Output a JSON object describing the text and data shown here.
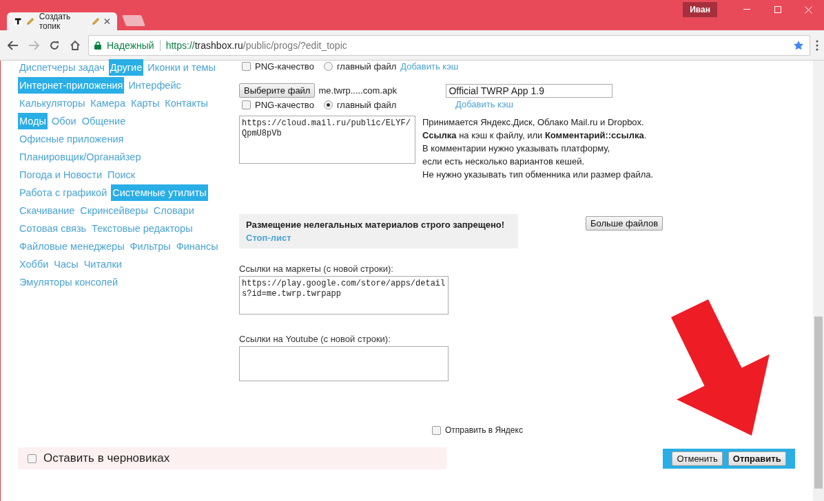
{
  "browser": {
    "tab": {
      "title": "Создать топик",
      "selected": true
    },
    "profile": "Иван",
    "address": {
      "security": "Надежный",
      "scheme": "https://",
      "host": "trashbox.ru",
      "path": "/public/progs/?edit_topic"
    }
  },
  "categories": [
    [
      {
        "label": "Диспетчеры задач",
        "selected": false
      },
      {
        "label": "Другие",
        "selected": true
      },
      {
        "label": "Иконки и темы",
        "selected": false
      }
    ],
    [
      {
        "label": "Интернет-приложения",
        "selected": true
      },
      {
        "label": "Интерфейс",
        "selected": false
      }
    ],
    [
      {
        "label": "Калькуляторы",
        "selected": false
      },
      {
        "label": "Камера",
        "selected": false
      },
      {
        "label": "Карты",
        "selected": false
      },
      {
        "label": "Контакты",
        "selected": false
      }
    ],
    [
      {
        "label": "Моды",
        "selected": true
      },
      {
        "label": "Обои",
        "selected": false
      },
      {
        "label": "Общение",
        "selected": false
      }
    ],
    [
      {
        "label": "Офисные приложения",
        "selected": false
      }
    ],
    [
      {
        "label": "Планировщик/Органайзер",
        "selected": false
      }
    ],
    [
      {
        "label": "Погода и Новости",
        "selected": false
      },
      {
        "label": "Поиск",
        "selected": false
      }
    ],
    [
      {
        "label": "Работа с графикой",
        "selected": false
      },
      {
        "label": "Системные утилиты",
        "selected": true
      }
    ],
    [
      {
        "label": "Скачивание",
        "selected": false
      },
      {
        "label": "Скринсейверы",
        "selected": false
      },
      {
        "label": "Словари",
        "selected": false
      }
    ],
    [
      {
        "label": "Сотовая связь",
        "selected": false
      },
      {
        "label": "Текстовые редакторы",
        "selected": false
      }
    ],
    [
      {
        "label": "Файловые менеджеры",
        "selected": false
      },
      {
        "label": "Фильтры",
        "selected": false
      },
      {
        "label": "Финансы",
        "selected": false
      }
    ],
    [
      {
        "label": "Хобби",
        "selected": false
      },
      {
        "label": "Часы",
        "selected": false
      },
      {
        "label": "Читалки",
        "selected": false
      }
    ],
    [
      {
        "label": "Эмуляторы консолей",
        "selected": false
      }
    ]
  ],
  "form": {
    "top_options": {
      "png": {
        "label": "PNG-качество",
        "checked": false
      },
      "main": {
        "label": "главный файл",
        "selected": false
      },
      "cache_link": "Добавить кэш"
    },
    "file": {
      "button": "Выберите файл",
      "filename": "me.twrp.....com.apk",
      "title_value": "Official TWRP App 1.9",
      "png": {
        "label": "PNG-качество",
        "checked": false
      },
      "main": {
        "label": "главный файл",
        "selected": true
      },
      "cache_link": "Добавить кэш",
      "link_value": "https://cloud.mail.ru/public/ELYF/QpmU8pVb",
      "help": [
        "Принимается Яндекс.Диск, Облако Mail.ru и Dropbox.",
        "**Ссылка** на кэш к файлу, или **Комментарий::ссылка**.",
        "В комментарии нужно указывать платформу,",
        "если есть несколько вариантов кешей.",
        "Не нужно указывать тип обменника или размер файла."
      ]
    },
    "notice": {
      "text": "Размещение нелегальных материалов строго запрещено!",
      "link": "Стоп-лист"
    },
    "more_files": "Больше файлов",
    "markets": {
      "label": "Ссылки на маркеты (с новой строки):",
      "value": "https://play.google.com/store/apps/details?id=me.twrp.twrpapp"
    },
    "youtube": {
      "label": "Ссылки на Youtube (с новой строки):"
    },
    "yandex": {
      "label": "Отправить в Яндекс",
      "checked": false
    },
    "draft": {
      "label": "Оставить в черновиках",
      "checked": false
    },
    "buttons": [
      {
        "label": "Отменить",
        "kind": "cancel"
      },
      {
        "label": "Отправить",
        "kind": "submit"
      }
    ]
  }
}
